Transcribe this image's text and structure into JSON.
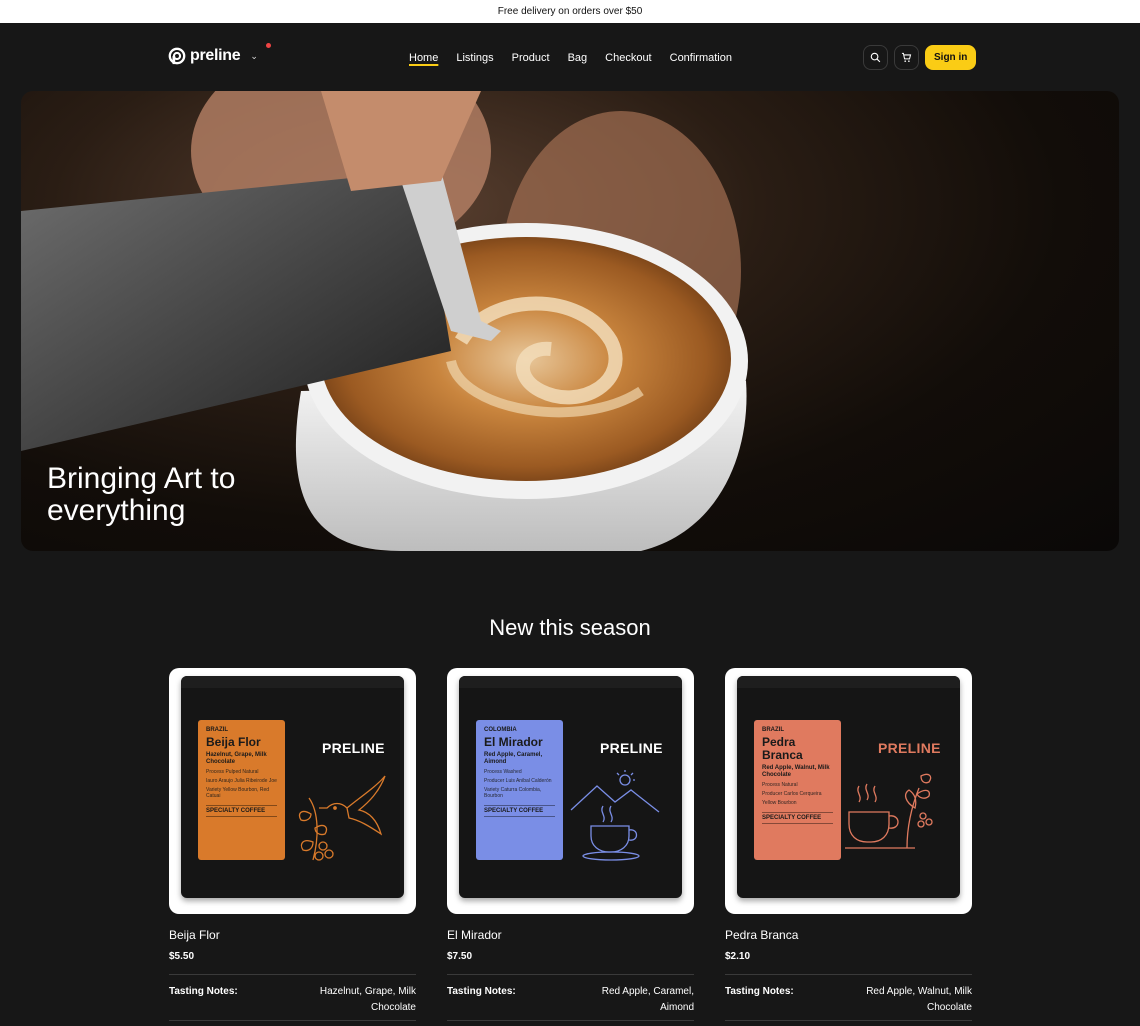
{
  "announcement": "Free delivery on orders over $50",
  "brand": {
    "name": "preline"
  },
  "nav": {
    "items": [
      {
        "label": "Home",
        "active": true
      },
      {
        "label": "Listings",
        "active": false
      },
      {
        "label": "Product",
        "active": false
      },
      {
        "label": "Bag",
        "active": false
      },
      {
        "label": "Checkout",
        "active": false
      },
      {
        "label": "Confirmation",
        "active": false
      }
    ],
    "sign_in": "Sign in",
    "icons": [
      "search-icon",
      "cart-icon"
    ]
  },
  "hero": {
    "title_line1": "Bringing Art to",
    "title_line2": "everything"
  },
  "section": {
    "title": "New this season"
  },
  "colors": {
    "accent": "#facc15",
    "background": "#171717",
    "orange": "#d97a2b",
    "blue": "#7a8ee6",
    "salmon": "#e07a5f"
  },
  "products": [
    {
      "name": "Beija Flor",
      "price": "$5.50",
      "notes_label": "Tasting Notes:",
      "notes": "Hazelnut, Grape, Milk Chocolate",
      "bag": {
        "origin": "BRAZIL",
        "name": "Beija Flor",
        "notes": "Hazelnut, Grape, Milk Chocolate",
        "line1": "Process Pulped Natural",
        "line2": "Iauro Araujo Julia Ribeirode Joe",
        "line3": "Variety Yellow Bourbon, Red Catuai",
        "specialty": "SPECIALTY COFFEE",
        "brand": "PRELINE",
        "label_color": "#d97a2b",
        "brand_color": "#ffffff"
      }
    },
    {
      "name": "El Mirador",
      "price": "$7.50",
      "notes_label": "Tasting Notes:",
      "notes": "Red Apple, Caramel, Aimond",
      "bag": {
        "origin": "COLOMBIA",
        "name": "El Mirador",
        "notes": "Red Apple, Caramel, Aimond",
        "line1": "Process Washed",
        "line2": "Producer Luis Anibal Calderón",
        "line3": "Variety Caturra Colombia, Bourbon",
        "specialty": "SPECIALTY COFFEE",
        "brand": "PRELINE",
        "label_color": "#7a8ee6",
        "brand_color": "#ffffff"
      }
    },
    {
      "name": "Pedra Branca",
      "price": "$2.10",
      "notes_label": "Tasting Notes:",
      "notes": "Red Apple, Walnut, Milk Chocolate",
      "bag": {
        "origin": "BRAZIL",
        "name": "Pedra Branca",
        "notes": "Red Apple, Walnut, Milk Chocolate",
        "line1": "Process Natural",
        "line2": "Producer Carlos Cerqueira",
        "line3": "Yellow Bourbon",
        "specialty": "SPECIALTY COFFEE",
        "brand": "PRELINE",
        "label_color": "#e07a5f",
        "brand_color": "#e07a5f"
      }
    }
  ]
}
